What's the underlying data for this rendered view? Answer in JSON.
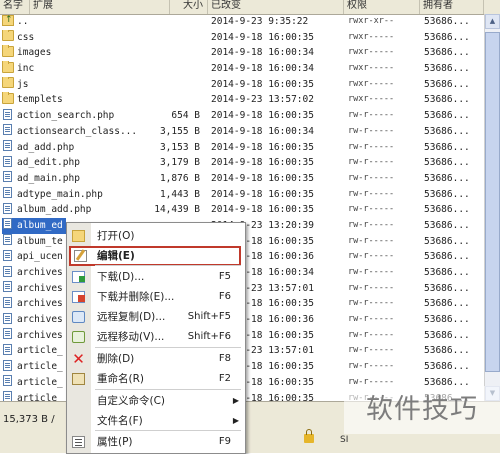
{
  "columns": {
    "name": "名字",
    "ext": "扩展",
    "size": "大小",
    "date": "已改变",
    "perm": "权限",
    "owner": "拥有者"
  },
  "files": [
    {
      "name": "..",
      "type": "up",
      "size": "",
      "date": "2014-9-23  9:35:22",
      "perm": "rwxr-xr--",
      "owner": "53686..."
    },
    {
      "name": "css",
      "type": "folder",
      "size": "",
      "date": "2014-9-18 16:00:35",
      "perm": "rwxr-----",
      "owner": "53686..."
    },
    {
      "name": "images",
      "type": "folder",
      "size": "",
      "date": "2014-9-18 16:00:34",
      "perm": "rwxr-----",
      "owner": "53686..."
    },
    {
      "name": "inc",
      "type": "folder",
      "size": "",
      "date": "2014-9-18 16:00:34",
      "perm": "rwxr-----",
      "owner": "53686..."
    },
    {
      "name": "js",
      "type": "folder",
      "size": "",
      "date": "2014-9-18 16:00:35",
      "perm": "rwxr-----",
      "owner": "53686..."
    },
    {
      "name": "templets",
      "type": "folder",
      "size": "",
      "date": "2014-9-23 13:57:02",
      "perm": "rwxr-----",
      "owner": "53686..."
    },
    {
      "name": "action_search.php",
      "type": "file",
      "size": "654 B",
      "date": "2014-9-18 16:00:35",
      "perm": "rw-r-----",
      "owner": "53686..."
    },
    {
      "name": "actionsearch_class...",
      "type": "file",
      "size": "3,155 B",
      "date": "2014-9-18 16:00:34",
      "perm": "rw-r-----",
      "owner": "53686..."
    },
    {
      "name": "ad_add.php",
      "type": "file",
      "size": "3,153 B",
      "date": "2014-9-18 16:00:35",
      "perm": "rw-r-----",
      "owner": "53686..."
    },
    {
      "name": "ad_edit.php",
      "type": "file",
      "size": "3,179 B",
      "date": "2014-9-18 16:00:35",
      "perm": "rw-r-----",
      "owner": "53686..."
    },
    {
      "name": "ad_main.php",
      "type": "file",
      "size": "1,876 B",
      "date": "2014-9-18 16:00:35",
      "perm": "rw-r-----",
      "owner": "53686..."
    },
    {
      "name": "adtype_main.php",
      "type": "file",
      "size": "1,443 B",
      "date": "2014-9-18 16:00:35",
      "perm": "rw-r-----",
      "owner": "53686..."
    },
    {
      "name": "album_add.php",
      "type": "file",
      "size": "14,439 B",
      "date": "2014-9-18 16:00:35",
      "perm": "rw-r-----",
      "owner": "53686..."
    },
    {
      "name": "album_ed",
      "type": "file",
      "size": "",
      "date": "2014-9-23 13:20:39",
      "perm": "rw-r-----",
      "owner": "53686...",
      "selected": true
    },
    {
      "name": "album_te",
      "type": "file",
      "size": "",
      "date": "2014-9-18 16:00:35",
      "perm": "rw-r-----",
      "owner": "53686..."
    },
    {
      "name": "api_ucen",
      "type": "file",
      "size": "",
      "date": "2014-9-18 16:00:36",
      "perm": "rw-r-----",
      "owner": "53686..."
    },
    {
      "name": "archives",
      "type": "file",
      "size": "",
      "date": "2014-9-18 16:00:34",
      "perm": "rw-r-----",
      "owner": "53686..."
    },
    {
      "name": "archives",
      "type": "file",
      "size": "",
      "date": "2014-9-23 13:57:01",
      "perm": "rw-r-----",
      "owner": "53686..."
    },
    {
      "name": "archives",
      "type": "file",
      "size": "",
      "date": "2014-9-18 16:00:35",
      "perm": "rw-r-----",
      "owner": "53686..."
    },
    {
      "name": "archives",
      "type": "file",
      "size": "",
      "date": "2014-9-18 16:00:36",
      "perm": "rw-r-----",
      "owner": "53686..."
    },
    {
      "name": "archives",
      "type": "file",
      "size": "",
      "date": "2014-9-18 16:00:35",
      "perm": "rw-r-----",
      "owner": "53686..."
    },
    {
      "name": "article_",
      "type": "file",
      "size": "",
      "date": "2014-9-23 13:57:01",
      "perm": "rw-r-----",
      "owner": "53686..."
    },
    {
      "name": "article_",
      "type": "file",
      "size": "",
      "date": "2014-9-18 16:00:35",
      "perm": "rw-r-----",
      "owner": "53686..."
    },
    {
      "name": "article_",
      "type": "file",
      "size": "",
      "date": "2014-9-18 16:00:35",
      "perm": "rw-r-----",
      "owner": "53686..."
    },
    {
      "name": "article_",
      "type": "file",
      "size": "",
      "date": "2014-9-18 16:00:35",
      "perm": "rw-r-----",
      "owner": "53686..."
    }
  ],
  "status": {
    "text": "15,373 B / ",
    "segment2": "SI"
  },
  "context_menu": {
    "items": [
      {
        "label": "打开(O)",
        "shortcut": "",
        "icon": "open-icon"
      },
      {
        "label": "编辑(E)",
        "shortcut": "",
        "icon": "edit-icon",
        "highlighted": true
      },
      {
        "label": "下载(D)...",
        "shortcut": "F5",
        "icon": "download-icon"
      },
      {
        "label": "下载并删除(E)...",
        "shortcut": "F6",
        "icon": "download-delete-icon"
      },
      {
        "label": "远程复制(D)...",
        "shortcut": "Shift+F5",
        "icon": "remote-copy-icon"
      },
      {
        "label": "远程移动(V)...",
        "shortcut": "Shift+F6",
        "icon": "remote-move-icon"
      },
      {
        "label": "删除(D)",
        "shortcut": "F8",
        "icon": "delete-icon"
      },
      {
        "label": "重命名(R)",
        "shortcut": "F2",
        "icon": "rename-icon"
      },
      {
        "label": "自定义命令(C)",
        "shortcut": "",
        "icon": "",
        "submenu": true
      },
      {
        "label": "文件名(F)",
        "shortcut": "",
        "icon": "",
        "submenu": true
      },
      {
        "label": "属性(P)",
        "shortcut": "F9",
        "icon": "properties-icon"
      }
    ]
  },
  "watermark": "软件技巧",
  "colors": {
    "selection": "#316ac5",
    "highlight_border": "#c0392b",
    "chrome": "#ece9d8"
  }
}
